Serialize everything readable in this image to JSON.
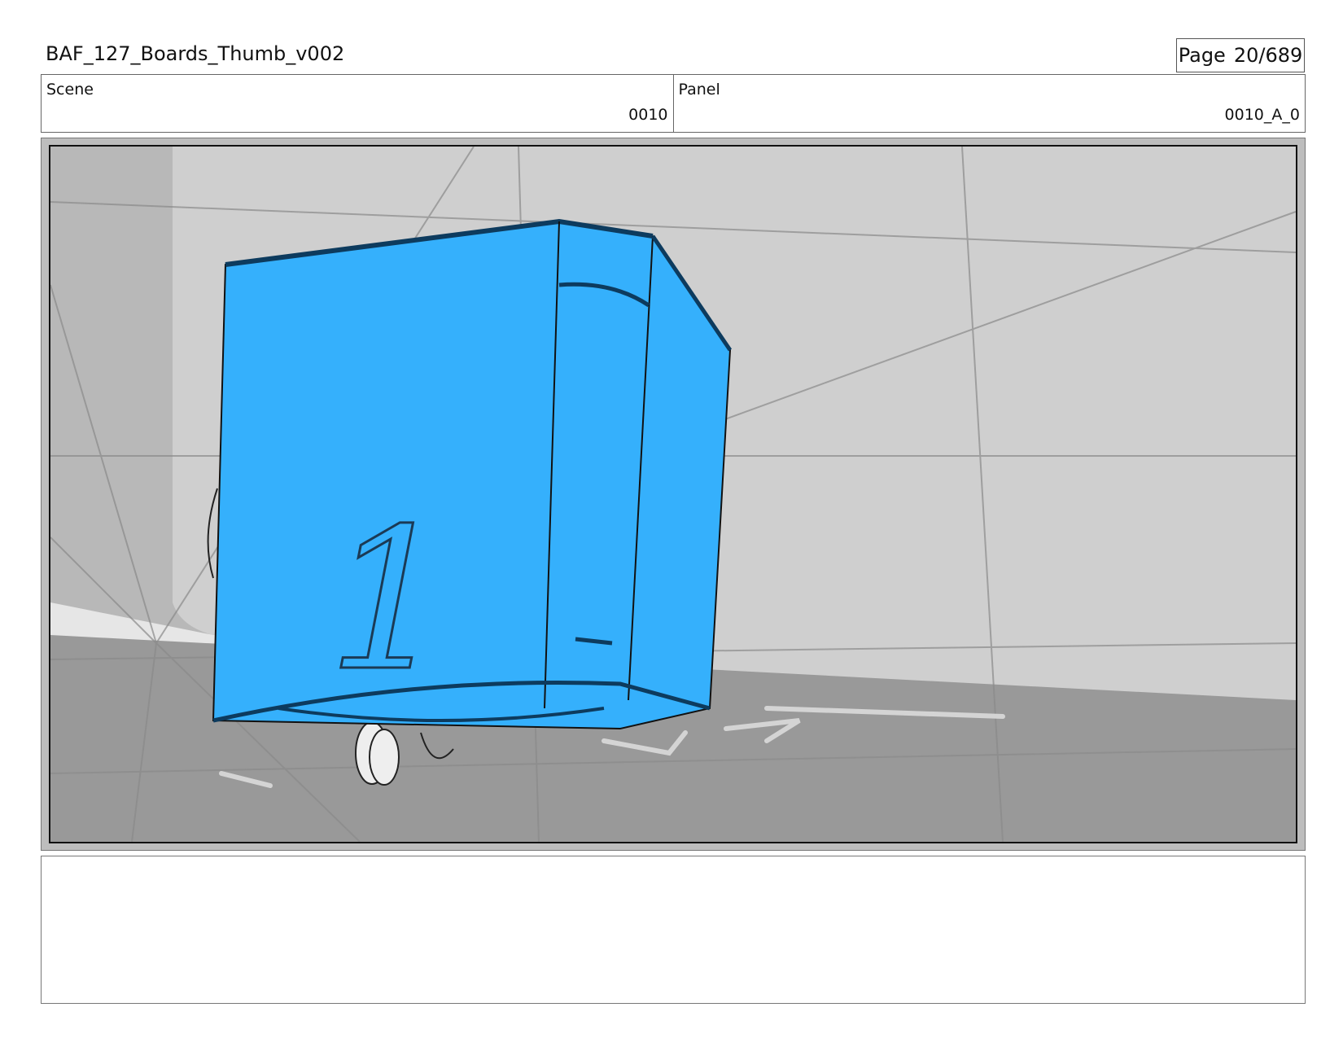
{
  "header": {
    "title": "BAF_127_Boards_Thumb_v002",
    "page_label": "Page",
    "page_number": "20/689"
  },
  "info": {
    "scene_label": "Scene",
    "scene_value": "0010",
    "panel_label": "Panel",
    "panel_value": "0010_A_0"
  },
  "artwork": {
    "box_glyph": "1",
    "box_color": "#35b0fc",
    "wall_color": "#cfcfcf",
    "floor_color": "#999999"
  },
  "notes": {
    "text": ""
  }
}
